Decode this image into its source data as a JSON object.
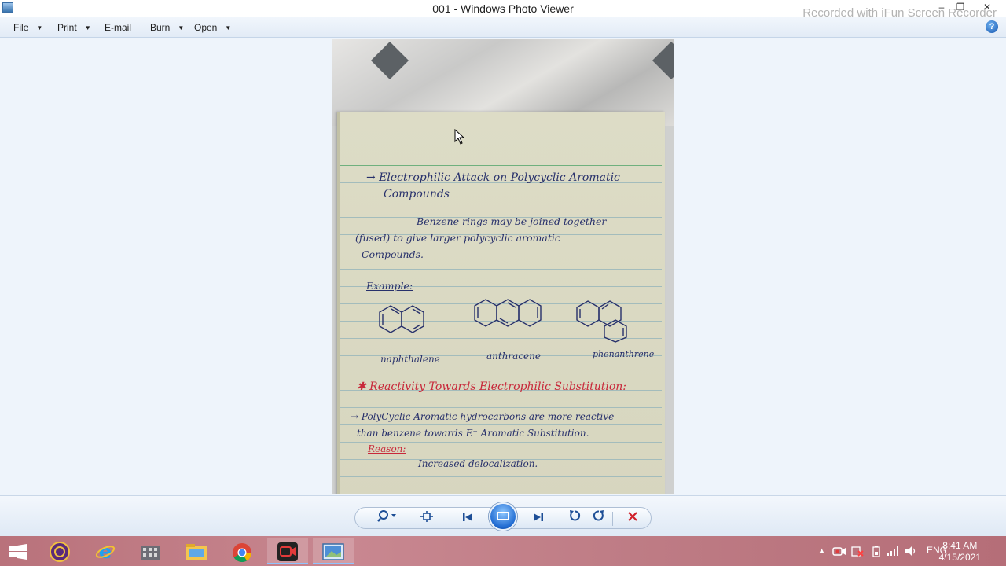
{
  "window": {
    "title": "001 - Windows Photo Viewer",
    "watermark": "Recorded with iFun Screen Recorder",
    "minimize_glyph": "–",
    "restore_glyph": "❐",
    "close_glyph": "✕"
  },
  "menu": {
    "items": [
      {
        "label": "File",
        "has_dropdown": true
      },
      {
        "label": "Print",
        "has_dropdown": true
      },
      {
        "label": "E-mail",
        "has_dropdown": false
      },
      {
        "label": "Burn",
        "has_dropdown": true
      },
      {
        "label": "Open",
        "has_dropdown": true
      }
    ],
    "help_glyph": "?"
  },
  "photo": {
    "heading_line1": "→ Electrophilic Attack on Polycyclic Aromatic",
    "heading_line2": "Compounds",
    "para_line1": "Benzene rings may be joined together",
    "para_line2": "(fused) to give larger polycyclic aromatic",
    "para_line3": "Compounds.",
    "example_label": "Example:",
    "molecules": [
      "naphthalene",
      "anthracene",
      "phenanthrene"
    ],
    "red_heading": "✱ Reactivity Towards Electrophilic Substitution:",
    "point_line1": "→ PolyCyclic Aromatic hydrocarbons are more reactive",
    "point_line2": "than benzene towards E⁺ Aromatic Substitution.",
    "reason_label": "Reason:",
    "reason_text": "Increased delocalization."
  },
  "toolbar": {
    "zoom_icon": "zoom-icon",
    "actual_size_icon": "actual-size-icon",
    "previous_icon": "previous-icon",
    "slideshow_icon": "play-slideshow-icon",
    "next_icon": "next-icon",
    "rotate_ccw_icon": "rotate-counterclockwise-icon",
    "rotate_cw_icon": "rotate-clockwise-icon",
    "delete_icon": "delete-icon",
    "accent_color": "#1d4e96",
    "delete_color": "#d0202a"
  },
  "taskbar": {
    "apps": [
      "start-icon",
      "app-circle-icon",
      "internet-explorer-icon",
      "app-building-icon",
      "file-explorer-icon",
      "chrome-icon",
      "screen-recorder-icon",
      "photo-viewer-icon"
    ],
    "language": "ENG",
    "time": "8:41 AM",
    "date": "4/15/2021"
  }
}
